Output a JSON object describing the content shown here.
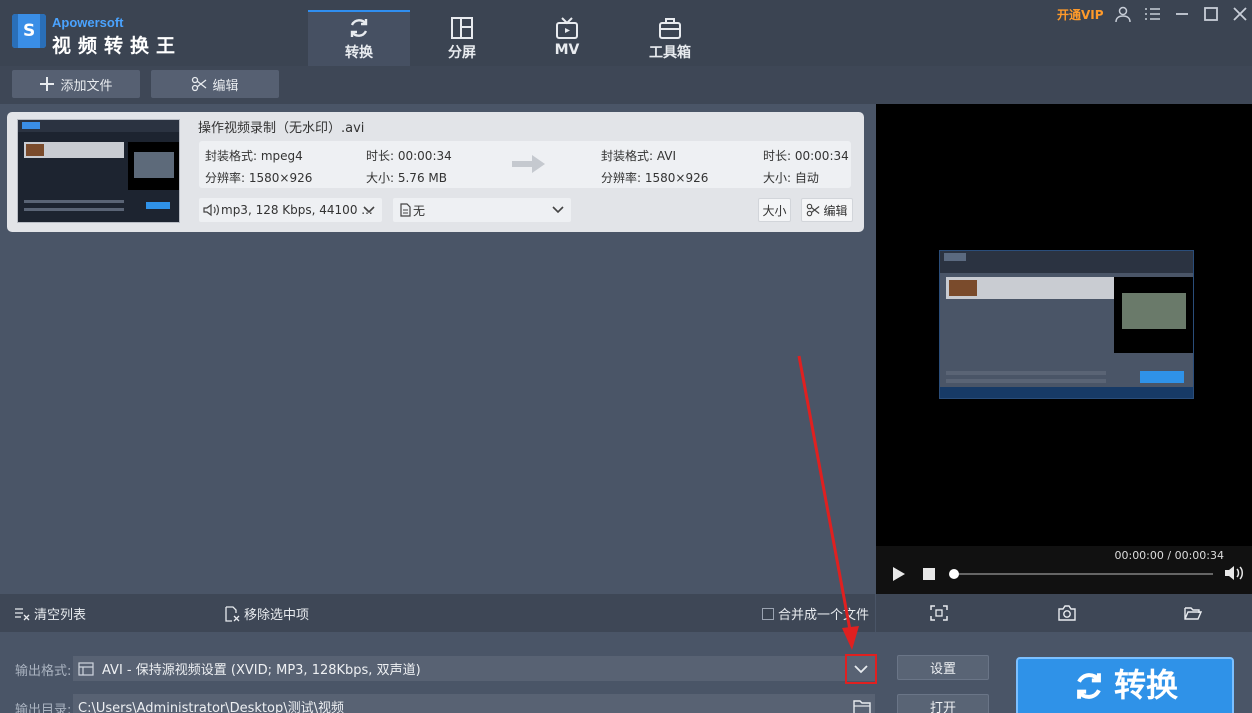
{
  "app": {
    "brand_en": "Apowersoft",
    "brand_cn": "视频转换王",
    "vip_label": "开通VIP"
  },
  "tabs": [
    {
      "label": "转换",
      "icon": "refresh-icon",
      "active": true
    },
    {
      "label": "分屏",
      "icon": "split-screen-icon",
      "active": false
    },
    {
      "label": "MV",
      "icon": "tv-icon",
      "active": false
    },
    {
      "label": "工具箱",
      "icon": "toolbox-icon",
      "active": false
    }
  ],
  "toolbar": {
    "add_file_label": "添加文件",
    "edit_label": "编辑"
  },
  "file": {
    "name": "操作视频录制（无水印）.avi",
    "source": {
      "container": "封装格式: mpeg4",
      "duration": "时长: 00:00:34",
      "resolution": "分辨率: 1580×926",
      "size": "大小: 5.76 MB"
    },
    "target": {
      "container": "封装格式: AVI",
      "duration": "时长: 00:00:34",
      "resolution": "分辨率: 1580×926",
      "size": "大小: 自动"
    },
    "audio_track": "mp3, 128 Kbps, 44100 ...",
    "subtitle": "无",
    "size_button": "大小",
    "edit_button": "编辑"
  },
  "preview": {
    "time": "00:00:00 / 00:00:34"
  },
  "list_actions": {
    "clear_label": "清空列表",
    "remove_label": "移除选中项",
    "merge_label": "合并成一个文件"
  },
  "output": {
    "format_label": "输出格式:",
    "format_value": "AVI - 保持源视频设置 (XVID; MP3, 128Kbps, 双声道)",
    "settings_button": "设置",
    "dir_label": "输出目录:",
    "dir_value": "C:\\Users\\Administrator\\Desktop\\测试\\视频",
    "open_button": "打开",
    "convert_button": "转换"
  },
  "colors": {
    "accent": "#2f92e8",
    "highlight": "#e02020",
    "vip": "#ff9a2a"
  }
}
